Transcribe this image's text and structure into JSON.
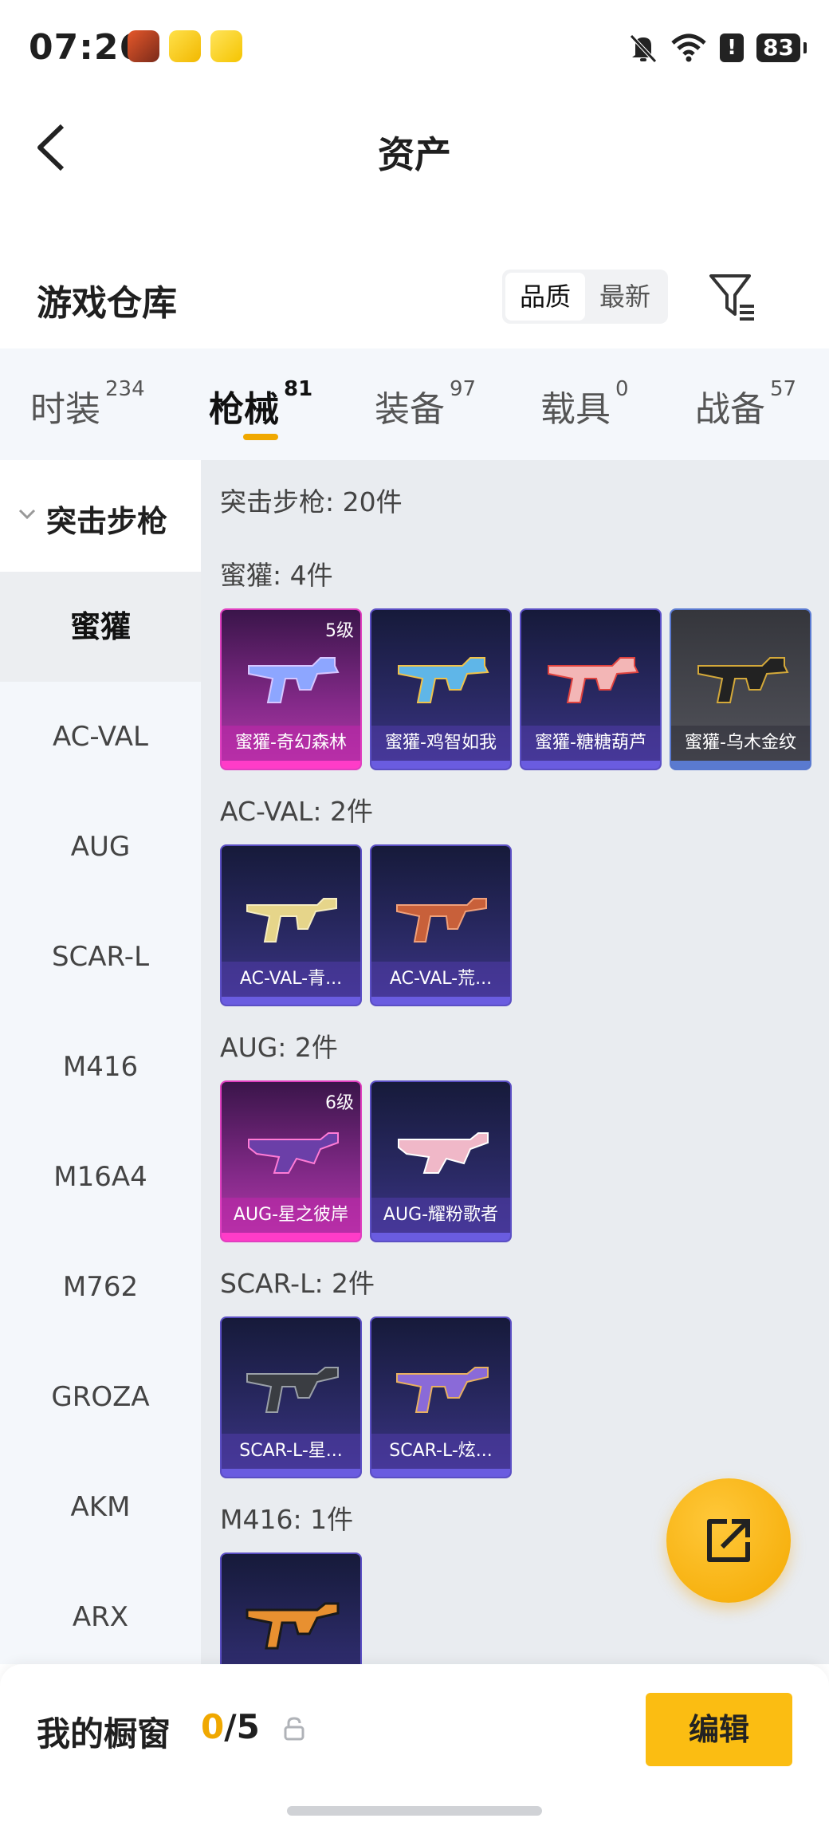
{
  "status_bar": {
    "time": "07:26",
    "battery": "83",
    "icons": [
      "mute-icon",
      "wifi-icon",
      "alert-icon",
      "battery-icon"
    ],
    "alert": "!"
  },
  "header": {
    "title": "资产"
  },
  "section": {
    "title": "游戏仓库",
    "sort": {
      "quality": "品质",
      "newest": "最新",
      "selected": "品质"
    }
  },
  "tabs": [
    {
      "label": "时装",
      "count": "234"
    },
    {
      "label": "枪械",
      "count": "81"
    },
    {
      "label": "装备",
      "count": "97"
    },
    {
      "label": "载具",
      "count": "0"
    },
    {
      "label": "战备",
      "count": "57"
    }
  ],
  "active_tab": "枪械",
  "sidebar": {
    "group": "突击步枪",
    "items": [
      "蜜獾",
      "AC-VAL",
      "AUG",
      "SCAR-L",
      "M416",
      "M16A4",
      "M762",
      "GROZA",
      "AKM",
      "ARX"
    ],
    "selected": "蜜獾"
  },
  "content": {
    "summary": "突击步枪: 20件",
    "groups": [
      {
        "title": "蜜獾: 4件",
        "items": [
          {
            "name": "蜜獾-奇幻森林",
            "level": "5级",
            "rarity": "pink"
          },
          {
            "name": "蜜獾-鸡智如我",
            "level": "",
            "rarity": "purple"
          },
          {
            "name": "蜜獾-糖糖葫芦",
            "level": "",
            "rarity": "purple"
          },
          {
            "name": "蜜獾-乌木金纹",
            "level": "",
            "rarity": "gray"
          }
        ]
      },
      {
        "title": "AC-VAL: 2件",
        "items": [
          {
            "name": "AC-VAL-青...",
            "level": "",
            "rarity": "purple"
          },
          {
            "name": "AC-VAL-荒...",
            "level": "",
            "rarity": "purple"
          }
        ]
      },
      {
        "title": "AUG: 2件",
        "items": [
          {
            "name": "AUG-星之彼岸",
            "level": "6级",
            "rarity": "pink"
          },
          {
            "name": "AUG-耀粉歌者",
            "level": "",
            "rarity": "purple"
          }
        ]
      },
      {
        "title": "SCAR-L: 2件",
        "items": [
          {
            "name": "SCAR-L-星...",
            "level": "",
            "rarity": "purple"
          },
          {
            "name": "SCAR-L-炫...",
            "level": "",
            "rarity": "purple"
          }
        ]
      },
      {
        "title": "M416: 1件",
        "items": [
          {
            "name": "",
            "level": "",
            "rarity": "purple"
          }
        ]
      }
    ]
  },
  "bottom": {
    "label": "我的橱窗",
    "current": "0",
    "total": "/5",
    "edit": "编辑"
  },
  "colors": {
    "accent": "#f0a800",
    "button": "#fbbd12",
    "pink_rarity": "#e03fc0",
    "purple_rarity": "#5b4fc4"
  }
}
